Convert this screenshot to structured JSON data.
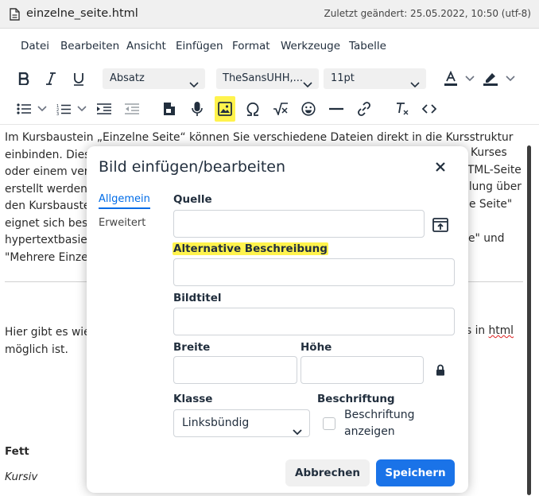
{
  "titlebar": {
    "file_name": "einzelne_seite.html",
    "meta": "Zuletzt geändert: 25.05.2022, 10:50  (utf-8)"
  },
  "menu": [
    "Datei",
    "Bearbeiten",
    "Ansicht",
    "Einfügen",
    "Format",
    "Werkzeuge",
    "Tabelle"
  ],
  "toolbar": {
    "block_format": "Absatz",
    "font_family": "TheSansUHH,...",
    "font_size": "11pt",
    "icons_row1": [
      "bold-icon",
      "italic-icon",
      "underline-icon",
      "text-color-icon",
      "highlight-color-icon"
    ],
    "icons_row2": [
      "bullet-list-icon",
      "numbered-list-icon",
      "indent-icon",
      "outdent-icon",
      "template-icon",
      "microphone-icon",
      "image-icon",
      "special-char-icon",
      "math-icon",
      "emoji-icon",
      "horizontal-line-icon",
      "link-icon",
      "clear-format-icon",
      "source-code-icon"
    ],
    "highlight_color": "#fff34d"
  },
  "document": {
    "lines": [
      "Im Kursbaustein „Einzelne Seite“ können Sie verschiedene Dateien direkt in die Kursstruktur",
      "einbinden. Diese"
    ],
    "fragments": [
      "oder einem verk",
      "erstellt werden.",
      "den Kursbaustei",
      "eignet sich beso",
      "hypertextbasier",
      "\"Mehrere Einzel"
    ],
    "right_fragments": [
      "Kurses",
      "TML-Seite",
      "ilung über",
      "e Seite\"",
      "e\" und"
    ],
    "para2_start": "Hier gibt es wie",
    "para2_right_a": "s in ",
    "para2_right_b": "html",
    "para2_line2": "möglich ist.",
    "bold_text": "Fett",
    "italic_text": "Kursiv"
  },
  "dialog": {
    "title": "Bild einfügen/bearbeiten",
    "tabs": [
      "Allgemein",
      "Erweitert"
    ],
    "fields": {
      "source_label": "Quelle",
      "alt_label": "Alternative Beschreibung",
      "title_label": "Bildtitel",
      "width_label": "Breite",
      "height_label": "Höhe",
      "class_label": "Klasse",
      "class_value": "Linksbündig",
      "caption_label": "Beschriftung",
      "caption_checkbox_label": "Beschriftung anzeigen"
    },
    "buttons": {
      "cancel": "Abbrechen",
      "save": "Speichern"
    },
    "accent_color": "#006ce7"
  }
}
